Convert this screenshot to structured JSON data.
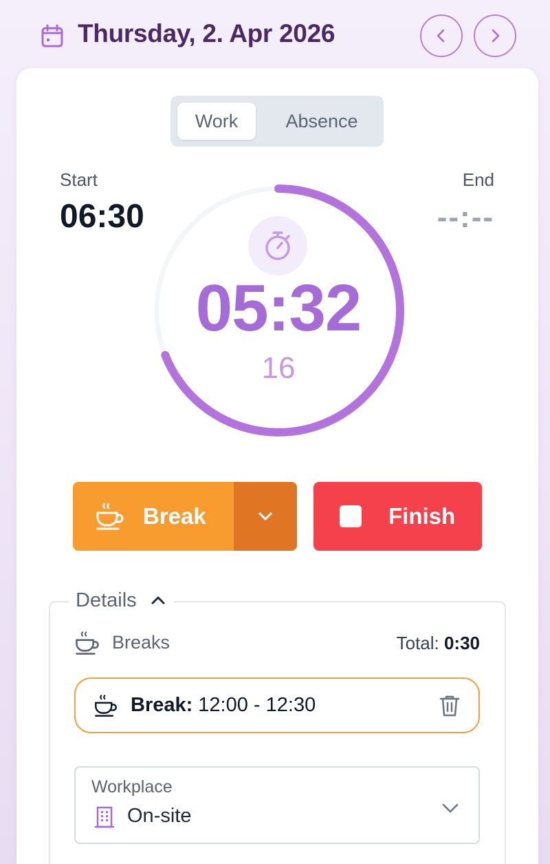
{
  "header": {
    "date_title": "Thursday, 2. Apr 2026",
    "calendar_icon": "calendar-icon",
    "prev_icon": "chevron-left-icon",
    "next_icon": "chevron-right-icon"
  },
  "tabs": [
    {
      "label": "Work",
      "selected": true
    },
    {
      "label": "Absence",
      "selected": false
    }
  ],
  "times": {
    "start_label": "Start",
    "start_value": "06:30",
    "end_label": "End",
    "end_value": "--:--"
  },
  "timer": {
    "elapsed": "05:32",
    "seconds": "16",
    "icon": "stopwatch-icon",
    "progress": 0.69
  },
  "actions": {
    "break_label": "Break",
    "finish_label": "Finish"
  },
  "details": {
    "title": "Details",
    "expanded": true,
    "breaks_title": "Breaks",
    "total_label": "Total:",
    "total_value": "0:30",
    "break_entries": [
      {
        "label": "Break:",
        "range": "12:00 - 12:30"
      }
    ],
    "workplace_label": "Workplace",
    "workplace_value": "On-site"
  },
  "colors": {
    "accent": "#a56bd6",
    "header_text": "#4a2a62",
    "break": "#f89c2f",
    "break_dark": "#e07524",
    "finish": "#f4414c",
    "entry_border": "#f2a041"
  }
}
